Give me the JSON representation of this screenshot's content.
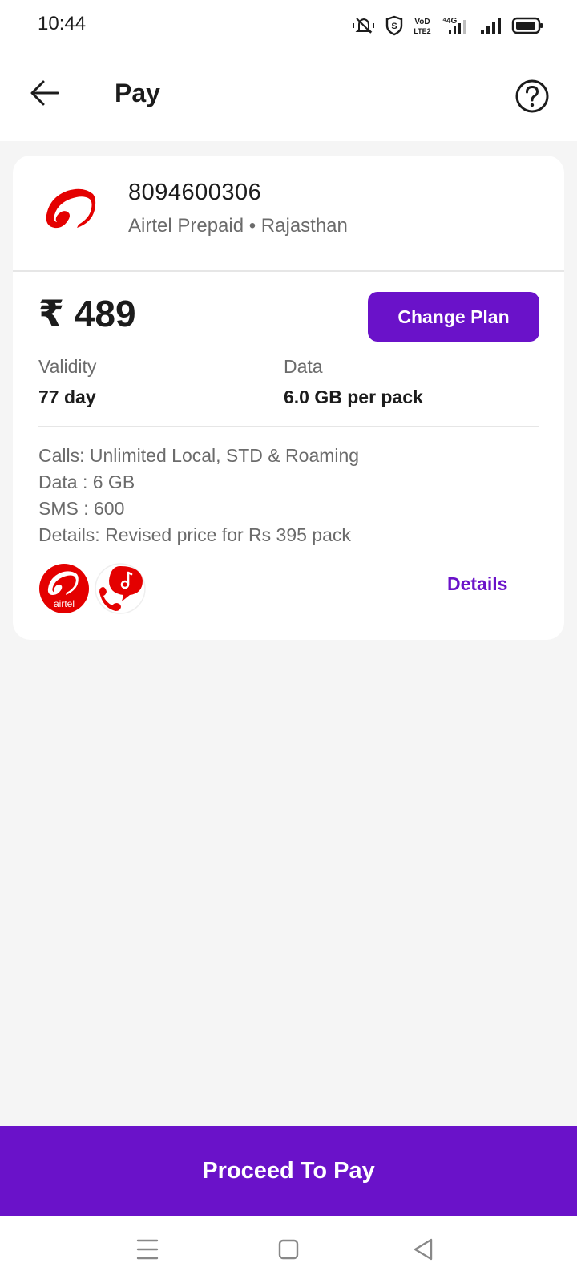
{
  "status_bar": {
    "time": "10:44",
    "icons": [
      "mute-vibrate-icon",
      "shield-icon",
      "volte-icon",
      "4g-signal-icon",
      "signal-icon",
      "battery-icon"
    ]
  },
  "header": {
    "title": "Pay",
    "back_icon": "arrow-left-icon",
    "help_icon": "question-circle-icon"
  },
  "recharge": {
    "mobile_number": "8094600306",
    "operator_info": "Airtel Prepaid • Rajasthan",
    "operator_logo": "airtel-logo"
  },
  "plan": {
    "price": "₹ 489",
    "change_plan_label": "Change Plan",
    "validity_label": "Validity",
    "validity_value": "77 day",
    "data_label": "Data",
    "data_value": "6.0 GB per pack",
    "benefits": [
      "Calls: Unlimited Local, STD & Roaming",
      "Data : 6 GB",
      "SMS : 600",
      "Details: Revised price for Rs 395 pack"
    ],
    "benefit_icons": [
      {
        "name": "airtel-app-icon",
        "label": "airtel"
      },
      {
        "name": "hellotunes-icon"
      }
    ],
    "details_label": "Details"
  },
  "footer": {
    "proceed_label": "Proceed To Pay"
  },
  "colors": {
    "accent": "#6a12c9",
    "airtel_red": "#e40000",
    "background": "#f5f5f5"
  }
}
